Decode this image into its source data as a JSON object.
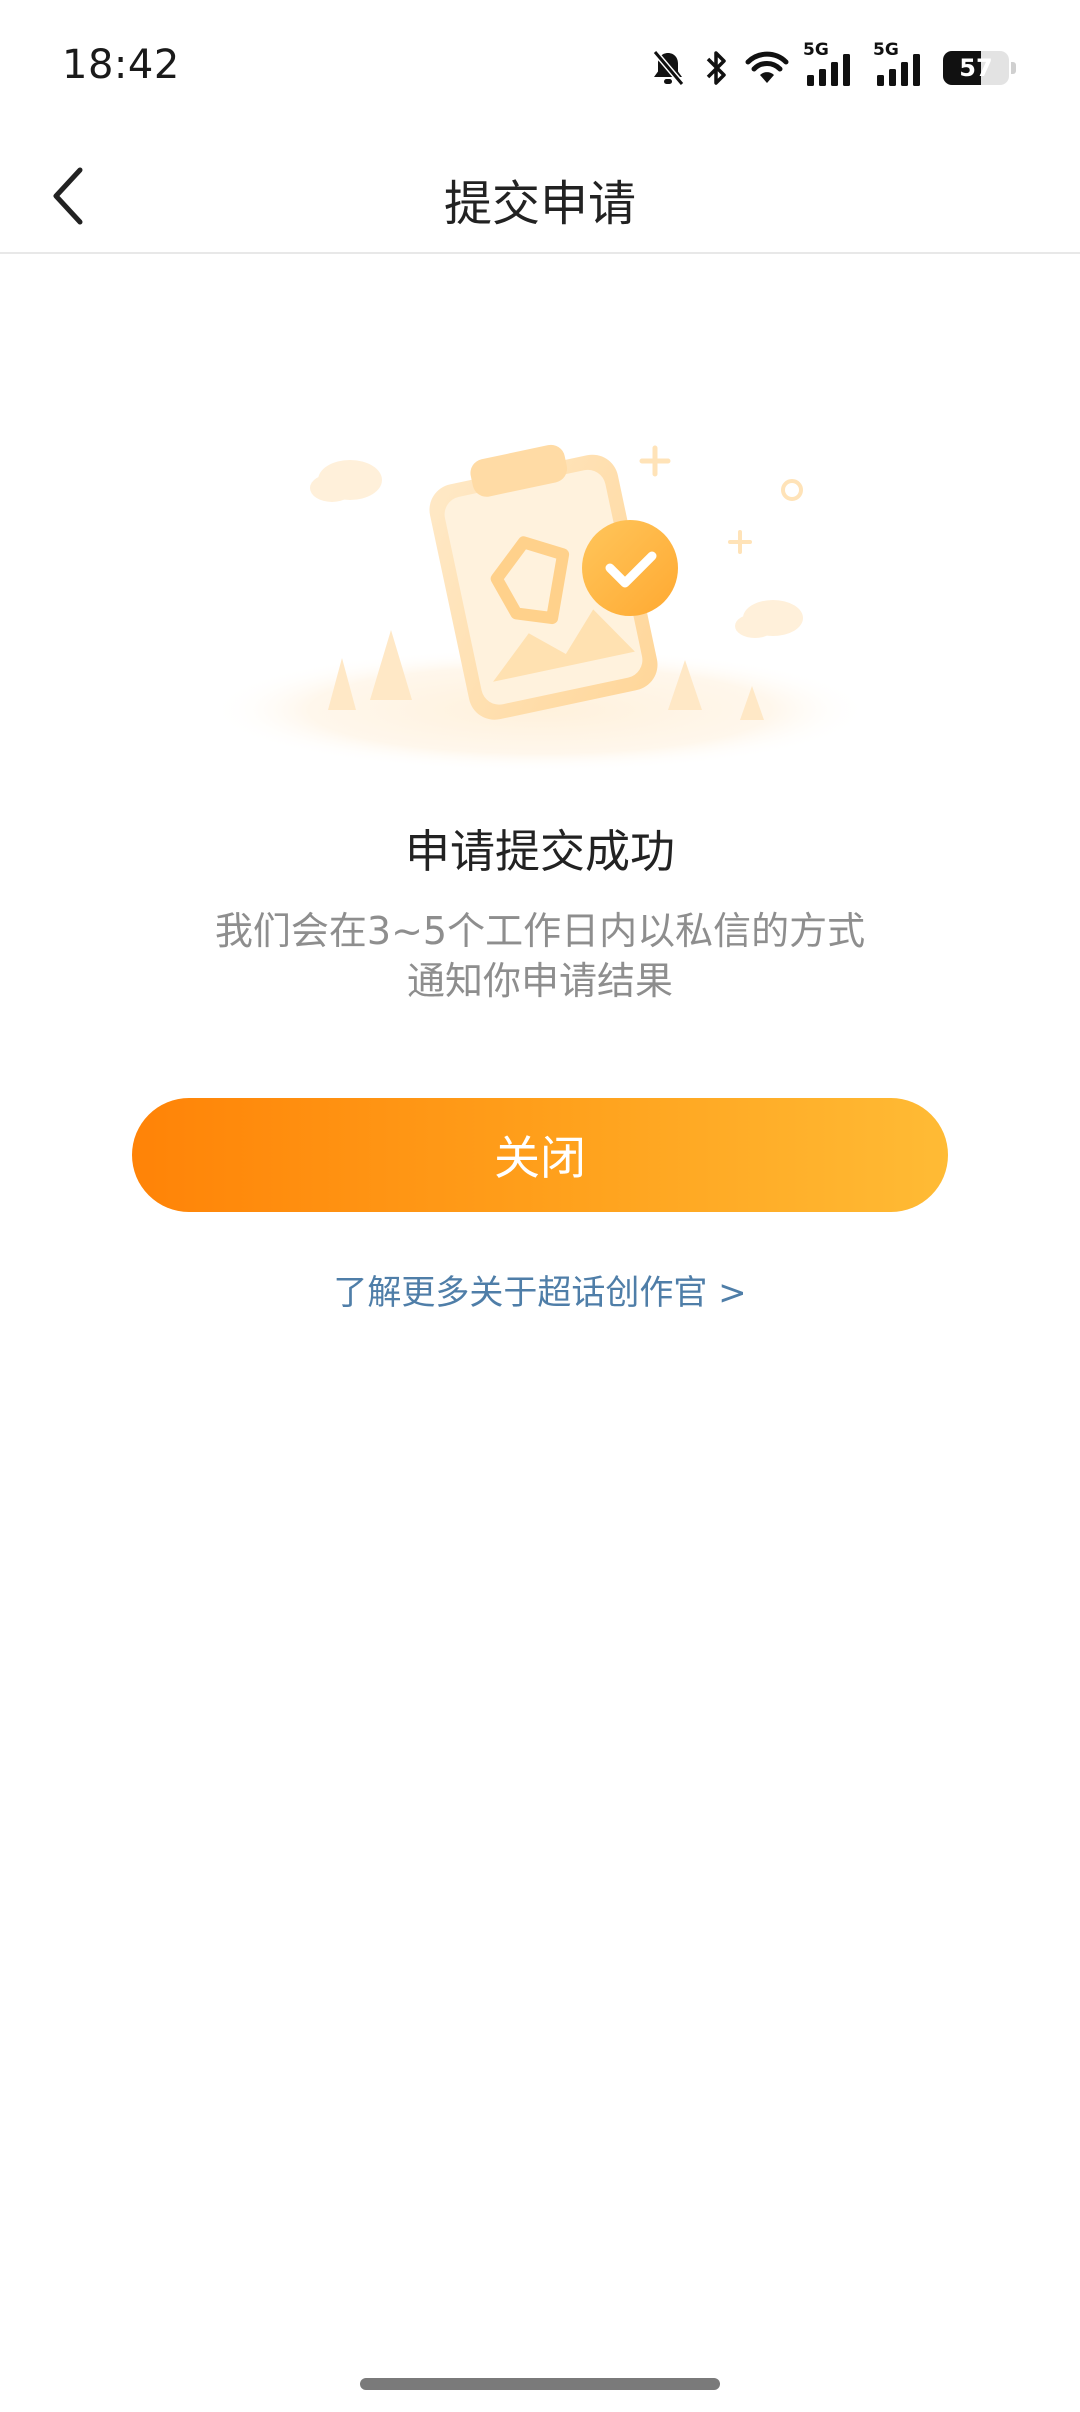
{
  "status_bar": {
    "time": "18:42",
    "network_1": "5G",
    "network_2": "5G",
    "battery_level": "57",
    "battery_fraction": 0.57,
    "icons": [
      "bell-off-icon",
      "bluetooth-icon",
      "wifi-icon",
      "signal-5g-icon",
      "signal-5g-icon",
      "battery-icon"
    ]
  },
  "nav": {
    "title": "提交申请",
    "back_icon": "chevron-left-icon"
  },
  "illustration": {
    "icon": "clipboard-check-illustration",
    "accent_color": "#ffb340"
  },
  "result": {
    "title": "申请提交成功",
    "desc_line1": "我们会在3~5个工作日内以私信的方式",
    "desc_line2": "通知你申请结果"
  },
  "actions": {
    "close_label": "关闭",
    "learn_more_label": "了解更多关于超话创作官 >"
  },
  "colors": {
    "button_gradient_start": "#ff8307",
    "button_gradient_end": "#ffbb35",
    "link": "#4f7ea8"
  }
}
